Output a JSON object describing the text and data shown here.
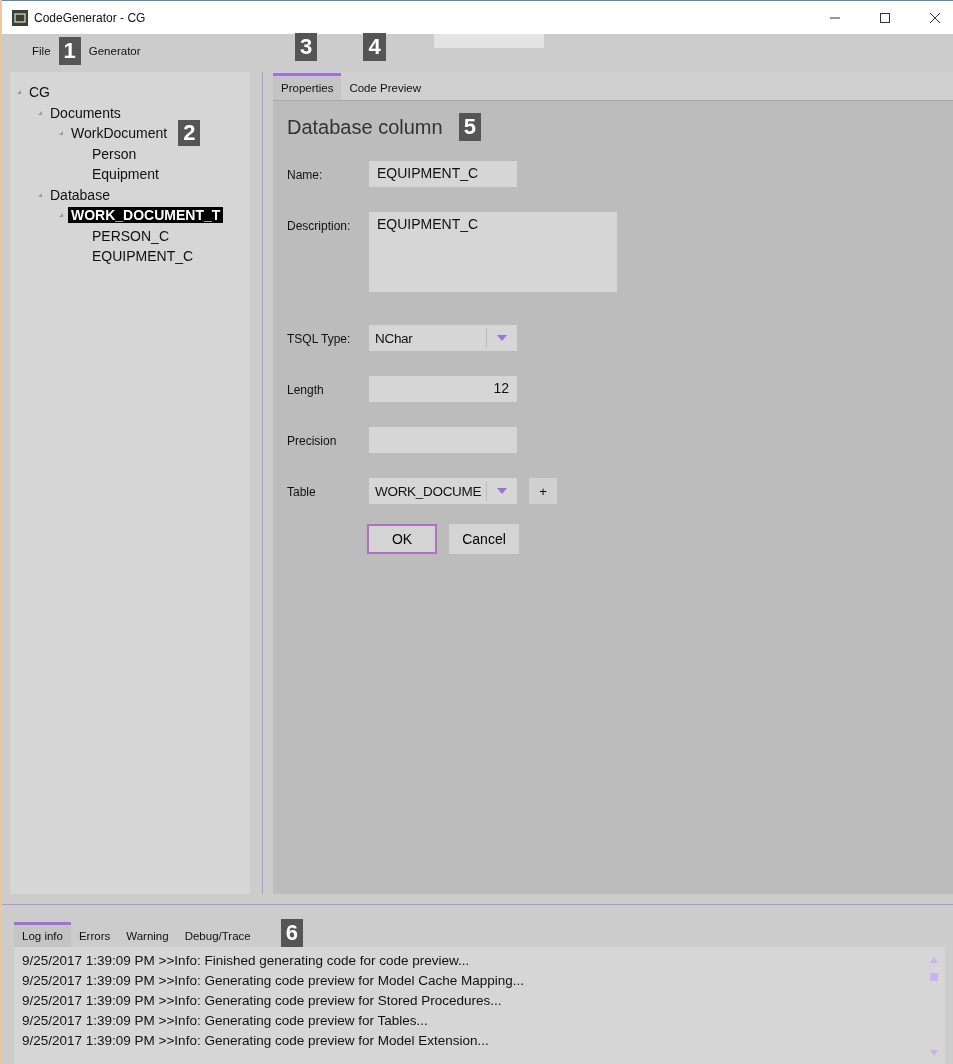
{
  "window": {
    "title": "CodeGenerator - CG"
  },
  "menu": {
    "items": [
      {
        "label": "File",
        "callout": "1"
      },
      {
        "label": "Generator"
      }
    ]
  },
  "tree": [
    {
      "label": "CG",
      "expanded": true,
      "selected": false,
      "children": [
        {
          "label": "Documents",
          "expanded": true,
          "selected": false,
          "children": [
            {
              "label": "WorkDocument",
              "expanded": true,
              "selected": false,
              "callout": "2",
              "children": [
                {
                  "label": "Person",
                  "selected": false
                },
                {
                  "label": "Equipment",
                  "selected": false
                }
              ]
            }
          ]
        },
        {
          "label": "Database",
          "expanded": true,
          "selected": false,
          "children": [
            {
              "label": "WORK_DOCUMENT_T",
              "expanded": true,
              "selected": true,
              "children": [
                {
                  "label": "PERSON_C",
                  "selected": false
                },
                {
                  "label": "EQUIPMENT_C",
                  "selected": false
                }
              ]
            }
          ]
        }
      ]
    }
  ],
  "tabs": [
    {
      "label": "Properties",
      "selected": true,
      "callout": "3"
    },
    {
      "label": "Code Preview",
      "selected": false,
      "callout": "4"
    }
  ],
  "form": {
    "heading": "Database column",
    "callout": "5",
    "fields": [
      {
        "kind": "text",
        "label": "Name:",
        "value": "EQUIPMENT_C"
      },
      {
        "kind": "textarea",
        "label": "Description:",
        "value": "EQUIPMENT_C"
      },
      {
        "kind": "dropdown",
        "label": "TSQL Type:",
        "value": "NChar"
      },
      {
        "kind": "number",
        "label": "Length",
        "value": "12"
      },
      {
        "kind": "number",
        "label": "Precision"
      },
      {
        "kind": "dropdown",
        "label": "Table",
        "value": "WORK_DOCUME",
        "add_button": "+"
      }
    ],
    "buttons": [
      {
        "label": "OK",
        "default": true
      },
      {
        "label": "Cancel",
        "default": false
      }
    ]
  },
  "log": {
    "callout": "6",
    "tabs": [
      {
        "label": "Log info",
        "selected": true
      },
      {
        "label": "Errors",
        "selected": false
      },
      {
        "label": "Warning",
        "selected": false
      },
      {
        "label": "Debug/Trace",
        "selected": false
      }
    ],
    "lines": [
      "9/25/2017 1:39:09 PM >>Info: Finished generating code for code preview...",
      "9/25/2017 1:39:09 PM >>Info: Generating code preview for Model Cache Mapping...",
      "9/25/2017 1:39:09 PM >>Info: Generating code preview for Stored Procedures...",
      "9/25/2017 1:39:09 PM >>Info: Generating code preview for Tables...",
      "9/25/2017 1:39:09 PM >>Info: Generating code preview for Model Extension..."
    ]
  }
}
